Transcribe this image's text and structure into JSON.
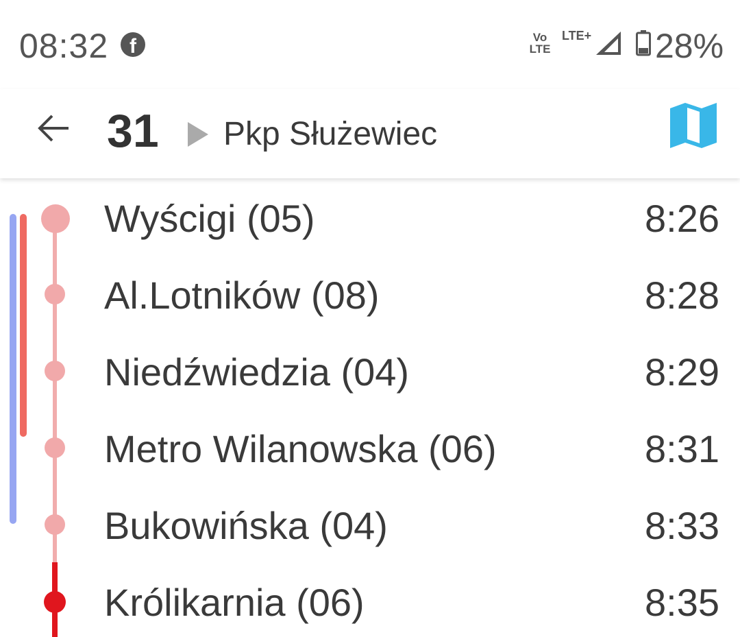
{
  "status_bar": {
    "time": "08:32",
    "notification_icon": "facebook-icon",
    "volte_top": "Vo",
    "volte_bottom": "LTE",
    "network": "LTE+",
    "battery": "28%"
  },
  "toolbar": {
    "back_icon": "arrow-left-icon",
    "line_number": "31",
    "direction": "Pkp Służewiec",
    "map_icon": "map-icon",
    "map_icon_color": "#39b7e8"
  },
  "stops": [
    {
      "name": "Wyścigi (05)",
      "time": "8:26"
    },
    {
      "name": "Al.Lotników (08)",
      "time": "8:28"
    },
    {
      "name": "Niedźwiedzia (04)",
      "time": "8:29"
    },
    {
      "name": "Metro Wilanowska (06)",
      "time": "8:31"
    },
    {
      "name": "Bukowińska (04)",
      "time": "8:33"
    },
    {
      "name": "Królikarnia (06)",
      "time": "8:35"
    }
  ],
  "colors": {
    "passed_stop": "#f1a9aa",
    "current_stop": "#e0161e",
    "side_blue": "#97a6f2",
    "side_red": "#ef6a62"
  }
}
